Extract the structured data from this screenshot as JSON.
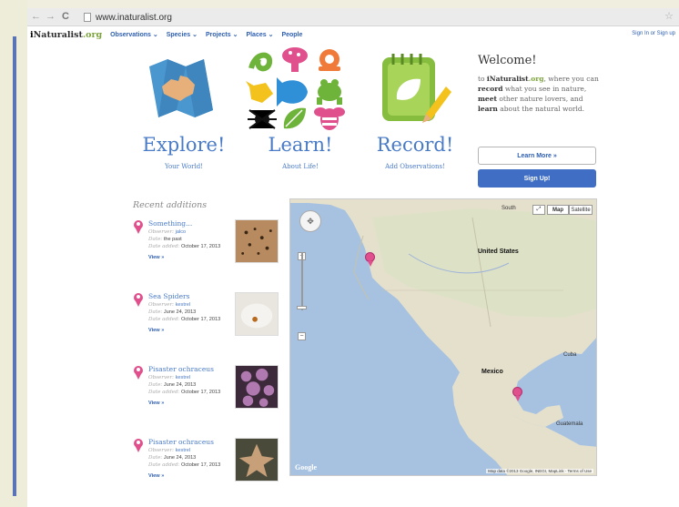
{
  "browser": {
    "back": "←",
    "forward": "→",
    "reload": "C",
    "url": "www.inaturalist.org",
    "star": "☆"
  },
  "nav": {
    "logo_i": "i",
    "logo_name": "Naturalist",
    "logo_org": ".org",
    "items": [
      "Observations ⌄",
      "Species ⌄",
      "Projects ⌄",
      "Places ⌄",
      "People"
    ],
    "auth": "Sign In or Sign up"
  },
  "hero": [
    {
      "title": "Explore!",
      "subtitle": "Your World!"
    },
    {
      "title": "Learn!",
      "subtitle": "About Life!"
    },
    {
      "title": "Record!",
      "subtitle": "Add Observations!"
    }
  ],
  "welcome": {
    "heading": "Welcome!",
    "intro": "to",
    "brand_i": "i",
    "brand_name": "Naturalist",
    "brand_org": ".org",
    "t1": ", where you can",
    "record": "record",
    "t2": "what you see in nature,",
    "meet": "meet",
    "t3": "other nature lovers, and",
    "learn": "learn",
    "t4": "about the natural world.",
    "learn_more": "Learn More »",
    "sign_up": "Sign Up!"
  },
  "recent": {
    "title": "Recent additions",
    "labels": {
      "observer": "Observer:",
      "date": "Date:",
      "added": "Date added:"
    },
    "view": "View »",
    "items": [
      {
        "name": "Something...",
        "observer": "jalco",
        "date": "the past",
        "added": "October 17, 2013"
      },
      {
        "name": "Sea Spiders",
        "observer": "kestrel",
        "date": "June 24, 2013",
        "added": "October 17, 2013"
      },
      {
        "name": "Pisaster ochraceus",
        "observer": "kestrel",
        "date": "June 24, 2013",
        "added": "October 17, 2013"
      },
      {
        "name": "Pisaster ochraceus",
        "observer": "kestrel",
        "date": "June 24, 2013",
        "added": "October 17, 2013"
      }
    ]
  },
  "map": {
    "map_btn": "Map",
    "sat_btn": "Satellite",
    "expand_btn": "⤢",
    "labels": {
      "south": "South",
      "us": "United States",
      "mexico": "Mexico",
      "cuba": "Cuba",
      "guatemala": "Guatemala"
    },
    "zoom_in": "+",
    "zoom_out": "−",
    "google": "Google",
    "copyright": "Map data ©2013 Google, INEGI, MapLink · Terms of Use"
  },
  "colors": {
    "link": "#4a7bc7",
    "accent_green": "#7ba43a",
    "pin": "#e0508c",
    "signup": "#3f6ec4"
  }
}
